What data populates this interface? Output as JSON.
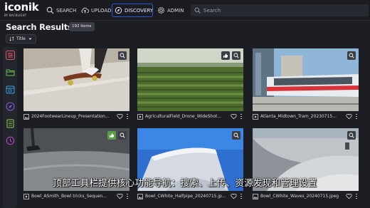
{
  "brand": {
    "name": "iconik",
    "tagline": "BY BACKLIGHT"
  },
  "nav": {
    "search": {
      "label": "SEARCH",
      "icon": "search-icon"
    },
    "upload": {
      "label": "UPLOAD",
      "icon": "cloud-upload-icon"
    },
    "discovery": {
      "label": "DISCOVERY",
      "icon": "compass-icon",
      "active": true
    },
    "admin": {
      "label": "ADMIN",
      "icon": "gear-icon"
    }
  },
  "global_search": {
    "placeholder": "Search"
  },
  "page": {
    "title": "Search Results",
    "count": "192 items",
    "sort_label": "Title"
  },
  "rail": [
    {
      "name": "filters-icon",
      "color": "#e0566b"
    },
    {
      "name": "folder-icon",
      "color": "#6cbf4a"
    },
    {
      "name": "calendar-icon",
      "color": "#3aa0e0"
    },
    {
      "name": "compass-icon",
      "color": "#8a5be0"
    },
    {
      "name": "document-icon",
      "color": "#8fd04a"
    },
    {
      "name": "history-icon",
      "color": "#c74ad0"
    }
  ],
  "results": [
    {
      "name": "2024FootwearLineup_Presentation...",
      "type": "image",
      "overlay": "zoom-icon"
    },
    {
      "name": "AgriculturalField_Drone_WideShot...",
      "type": "video",
      "overlay": "approval-icon+zoom-icon"
    },
    {
      "name": "Atlanta_Midtown_Tram_20230715...",
      "type": "video",
      "overlay": "zoom-icon"
    },
    {
      "name": "Bowl_ASmith_Bowl tricks_Sequen...",
      "type": "video",
      "overlay": "thumbs-up+zoom-icon"
    },
    {
      "name": "Bowl_CWhite_Halfpipe_20240715.jp...",
      "type": "image",
      "overlay": "zoom-icon"
    },
    {
      "name": "Bowl_CWhite_Waves_20240715.jpeg",
      "type": "image",
      "overlay": "zoom-icon"
    }
  ],
  "subtitle": "顶部工具栏提供核心功能导航：搜索、上传、资源发现和管理设置",
  "colors": {
    "accent": "#2a56d6",
    "background": "#1c1e23",
    "approved": "#5b9e43"
  }
}
